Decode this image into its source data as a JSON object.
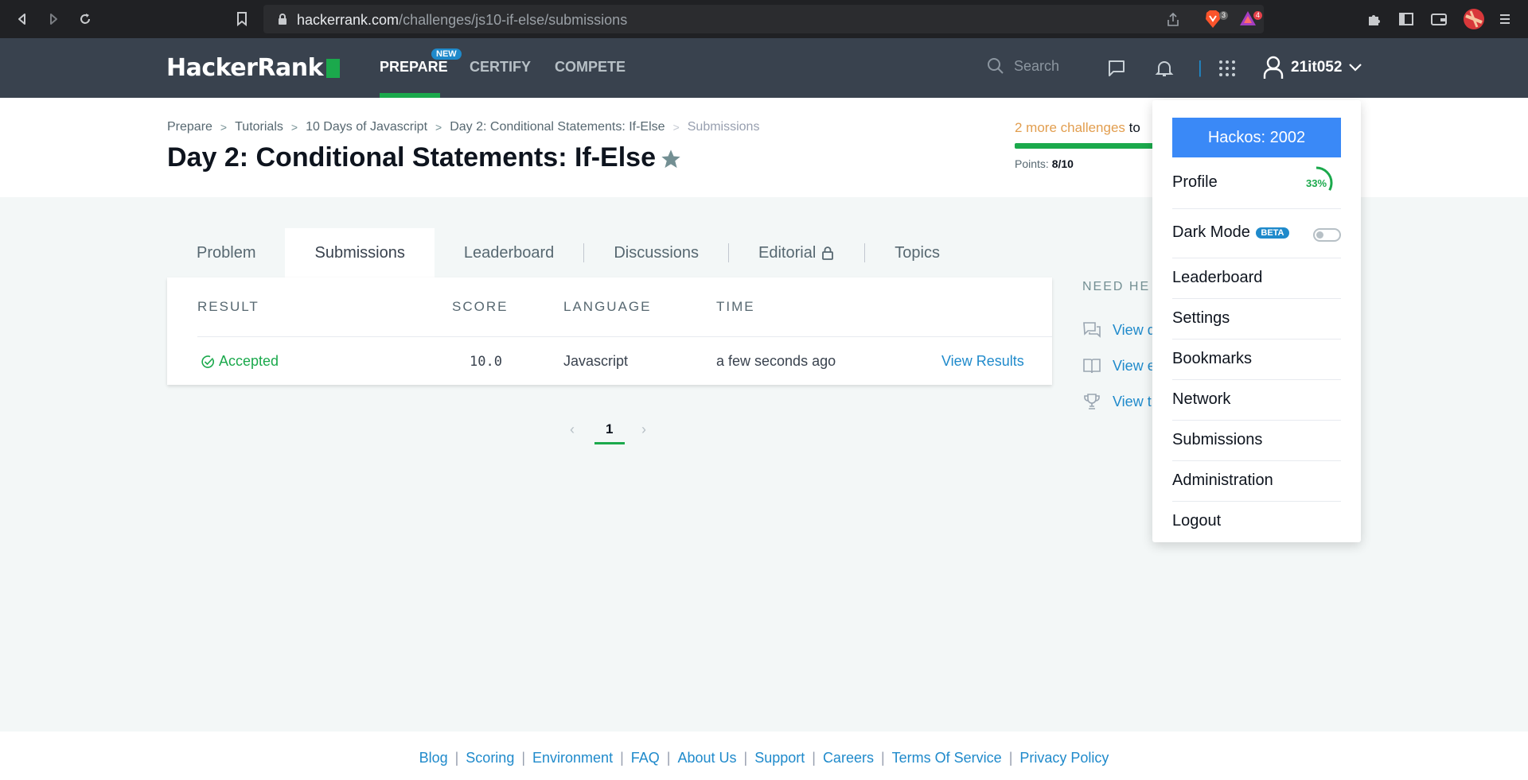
{
  "browser": {
    "url_domain": "hackerrank.com",
    "url_path": "/challenges/js10-if-else/submissions",
    "brave_shield_count": "3",
    "rewards_count": "4"
  },
  "header": {
    "logo": "HackerRank",
    "nav": [
      {
        "label": "PREPARE",
        "active": true
      },
      {
        "label": "CERTIFY",
        "active": false
      },
      {
        "label": "COMPETE",
        "active": false
      }
    ],
    "new_badge": "NEW",
    "search_placeholder": "Search",
    "username": "21it052"
  },
  "breadcrumb": [
    "Prepare",
    "Tutorials",
    "10 Days of Javascript",
    "Day 2: Conditional Statements: If-Else",
    "Submissions"
  ],
  "challenge": {
    "title": "Day 2: Conditional Statements: If-Else",
    "progress_highlight": "2 more challenges",
    "progress_rest": "to",
    "points_label": "Points:",
    "points_value": "8/10"
  },
  "tabs": [
    {
      "label": "Problem",
      "active": false
    },
    {
      "label": "Submissions",
      "active": true
    },
    {
      "label": "Leaderboard",
      "active": false
    },
    {
      "label": "Discussions",
      "active": false
    },
    {
      "label": "Editorial",
      "active": false,
      "locked": true
    },
    {
      "label": "Topics",
      "active": false
    }
  ],
  "submissions": {
    "columns": [
      "RESULT",
      "SCORE",
      "LANGUAGE",
      "TIME"
    ],
    "rows": [
      {
        "result": "Accepted",
        "score": "10.0",
        "language": "Javascript",
        "time": "a few seconds ago",
        "action": "View Results"
      }
    ]
  },
  "pagination": {
    "current": "1"
  },
  "need_help": {
    "title": "NEED HE",
    "links": [
      "View d",
      "View e",
      "View t"
    ]
  },
  "dropdown": {
    "hackos": "Hackos: 2002",
    "profile": "Profile",
    "profile_pct": "33%",
    "profile_pct_value": 0.33,
    "dark_mode": "Dark Mode",
    "beta": "BETA",
    "items": [
      "Leaderboard",
      "Settings",
      "Bookmarks",
      "Network",
      "Submissions",
      "Administration",
      "Logout"
    ]
  },
  "footer": {
    "links": [
      "Blog",
      "Scoring",
      "Environment",
      "FAQ",
      "About Us",
      "Support",
      "Careers",
      "Terms Of Service",
      "Privacy Policy"
    ]
  },
  "colors": {
    "brand_green": "#1ba94c",
    "header_bg": "#39424e",
    "link_blue": "#1f8acb",
    "hackos_blue": "#3a89f7",
    "orange": "#e29e4f"
  }
}
